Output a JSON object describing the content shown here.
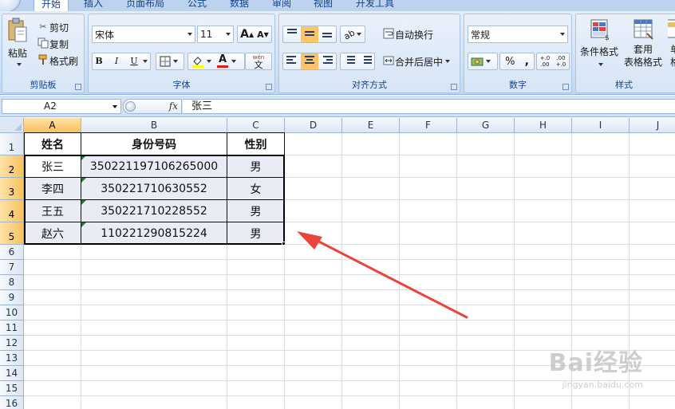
{
  "ribbon": {
    "tabs": [
      "开始",
      "插入",
      "页面布局",
      "公式",
      "数据",
      "审阅",
      "视图",
      "开发工具"
    ],
    "active_tab": "开始",
    "clipboard": {
      "paste": "粘贴",
      "cut": "剪切",
      "copy": "复制",
      "format_painter": "格式刷",
      "label": "剪贴板"
    },
    "font": {
      "name": "宋体",
      "size": "11",
      "label": "字体",
      "bold": "B",
      "italic": "I",
      "underline": "U",
      "grow": "A",
      "shrink": "A",
      "font_color": "A",
      "phonetic": "wén",
      "phonetic_char": "文"
    },
    "alignment": {
      "wrap": "自动换行",
      "merge": "合并后居中",
      "label": "对齐方式"
    },
    "number": {
      "format": "常规",
      "percent": "%",
      "comma": ",",
      "inc_dec": "+.0 .00",
      "dec_dec": ".00 +.0",
      "label": "数字"
    },
    "styles": {
      "conditional": "条件格式",
      "table_format_line1": "套用",
      "table_format_line2": "表格格式",
      "cell_styles": "单",
      "cell_styles2": "格",
      "label": "样式"
    }
  },
  "formula_bar": {
    "name_box": "A2",
    "fx": "fx",
    "value": "张三"
  },
  "grid": {
    "columns": [
      "A",
      "B",
      "C",
      "D",
      "E",
      "F",
      "G",
      "H",
      "I",
      "J"
    ],
    "rows": [
      "1",
      "2",
      "3",
      "4",
      "5",
      "6",
      "7",
      "8",
      "9",
      "10",
      "11",
      "12",
      "13",
      "14",
      "15",
      "16"
    ],
    "table": {
      "headers": [
        "姓名",
        "身份号码",
        "性别"
      ],
      "rows": [
        [
          "张三",
          "350221197106265000",
          "男"
        ],
        [
          "李四",
          "350221710630552",
          "女"
        ],
        [
          "王五",
          "350221710228552",
          "男"
        ],
        [
          "赵六",
          "110221290815224",
          "男"
        ]
      ]
    }
  },
  "annotation": {
    "arrow_color": "#e8453c"
  },
  "watermark": {
    "brand": "Bai经验",
    "url": "jingyan.baidu.com"
  }
}
